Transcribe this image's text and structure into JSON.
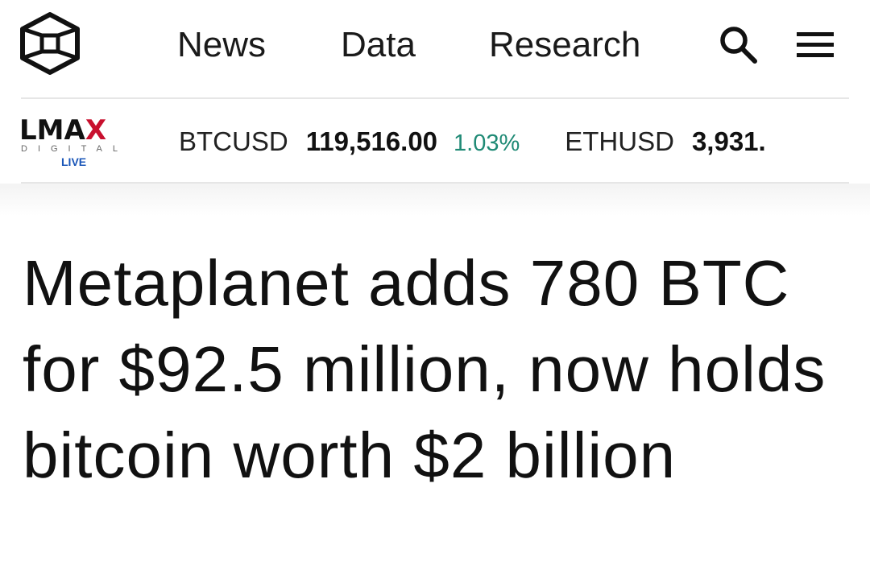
{
  "nav": {
    "logo_icon": "cube-logo-icon",
    "links": [
      {
        "label": "News"
      },
      {
        "label": "Data"
      },
      {
        "label": "Research"
      }
    ],
    "search_icon": "search-icon",
    "menu_icon": "hamburger-menu-icon"
  },
  "ticker": {
    "brand": {
      "word": "LMA",
      "word_x": "X",
      "sub": "DIGITAL",
      "live": "LIVE",
      "x_color": "#c8102e",
      "live_color": "#1a56b8"
    },
    "items": [
      {
        "symbol": "BTCUSD",
        "price": "119,516.00",
        "change": "1.03%",
        "change_color": "#1f8a75"
      },
      {
        "symbol": "ETHUSD",
        "price": "3,931."
      }
    ]
  },
  "article": {
    "headline": "Metaplanet adds 780 BTC for $92.5 million, now holds bitcoin worth $2 billion"
  }
}
